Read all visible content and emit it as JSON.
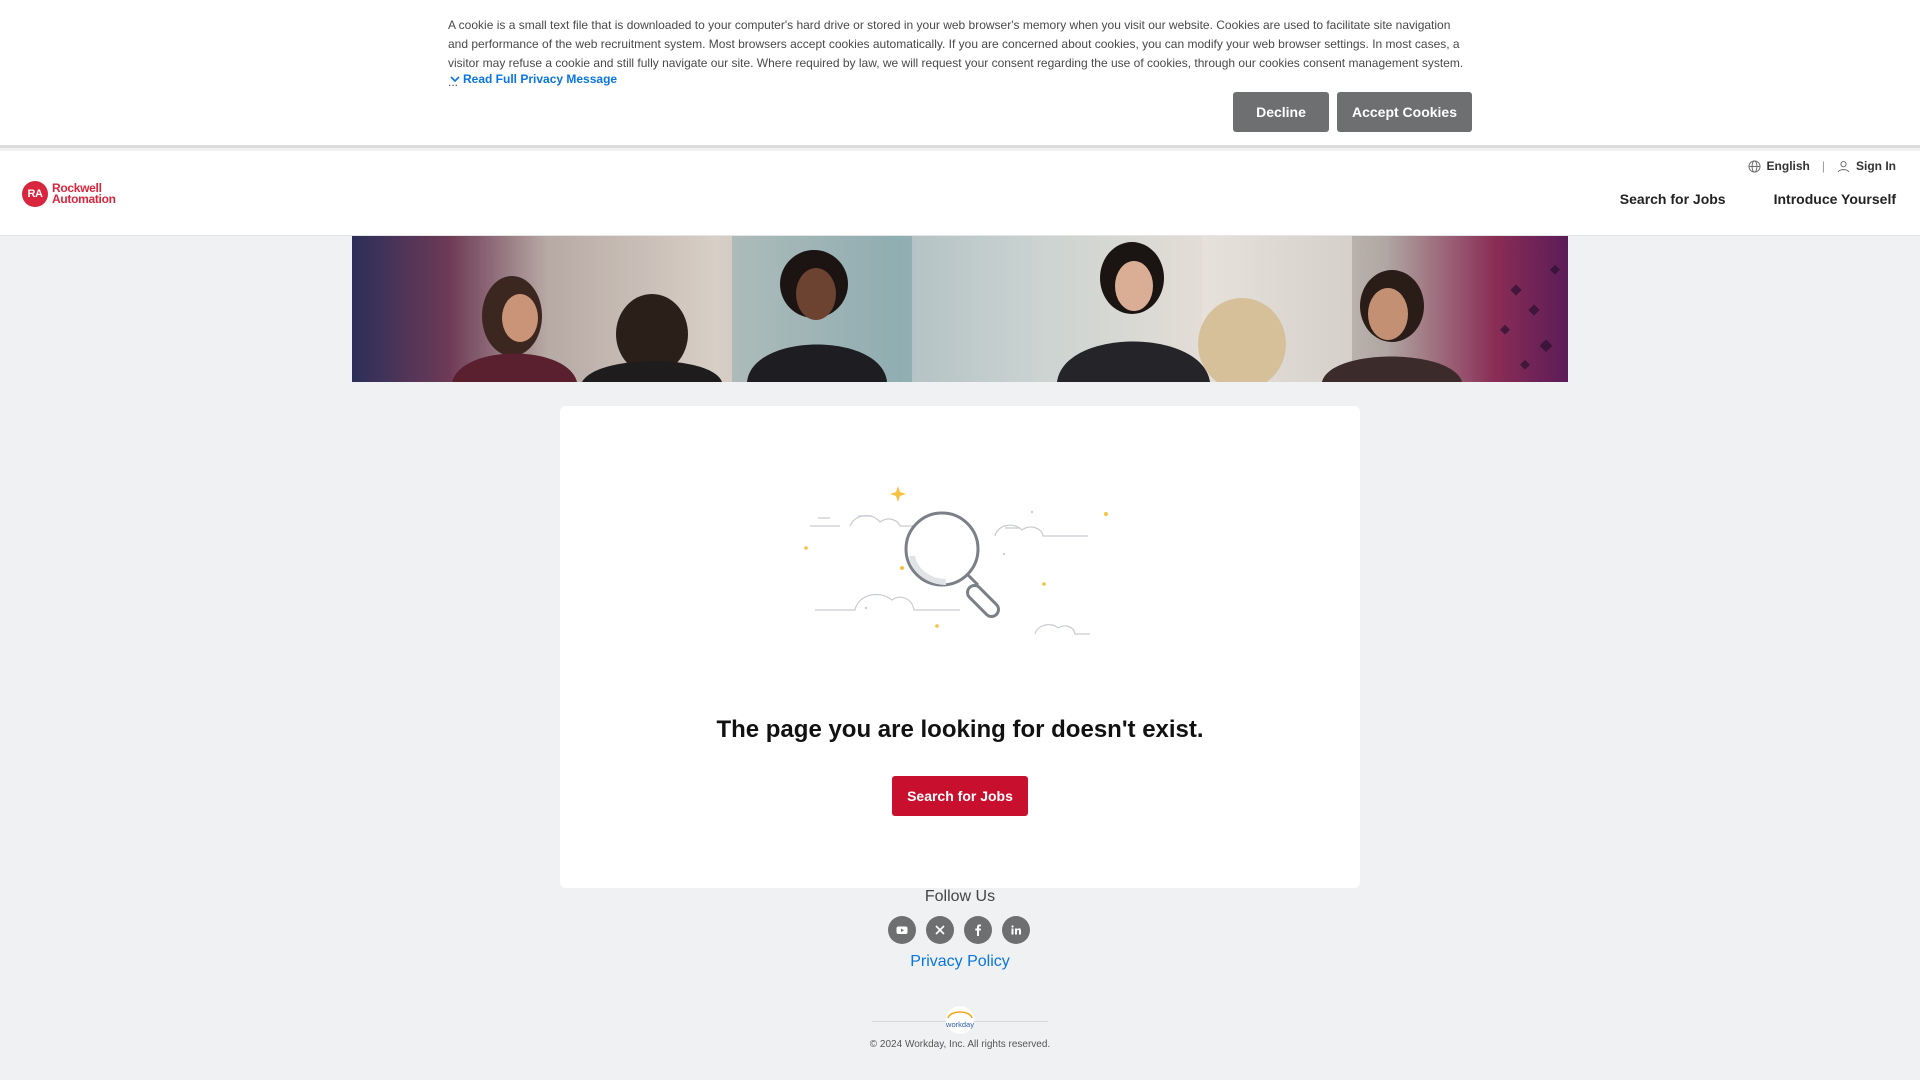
{
  "cookie_banner": {
    "text": "A cookie is a small text file that is downloaded to your computer's hard drive or stored in your web browser's memory when you visit our website. Cookies are used to facilitate site navigation and performance of the web recruitment system. Most browsers accept cookies automatically. If you are concerned about cookies, you can modify your web browser settings. In most cases, a visitor may refuse a cookie and still fully navigate our site. Where required by law, we will request your consent regarding the use of cookies, through our cookies consent management system. ...",
    "read_more": "Read Full Privacy Message",
    "decline": "Decline",
    "accept": "Accept Cookies"
  },
  "header": {
    "logo_text_1": "Rockwell",
    "logo_text_2": "Automation",
    "logo_mark": "RA",
    "language": "English",
    "sign_in": "Sign In",
    "nav": [
      "Search for Jobs",
      "Introduce Yourself"
    ]
  },
  "main": {
    "message": "The page you are looking for doesn't exist.",
    "button": "Search for Jobs"
  },
  "footer": {
    "follow_us": "Follow Us",
    "socials": [
      "youtube-icon",
      "x-icon",
      "facebook-icon",
      "linkedin-icon"
    ],
    "privacy_policy": "Privacy Policy",
    "copyright": "© 2024 Workday, Inc. All rights reserved.",
    "workday_logo_text": "workday"
  },
  "colors": {
    "brand_red": "#c8102e",
    "link_blue": "#0875e1",
    "cookie_button_gray": "#6e6f71"
  }
}
